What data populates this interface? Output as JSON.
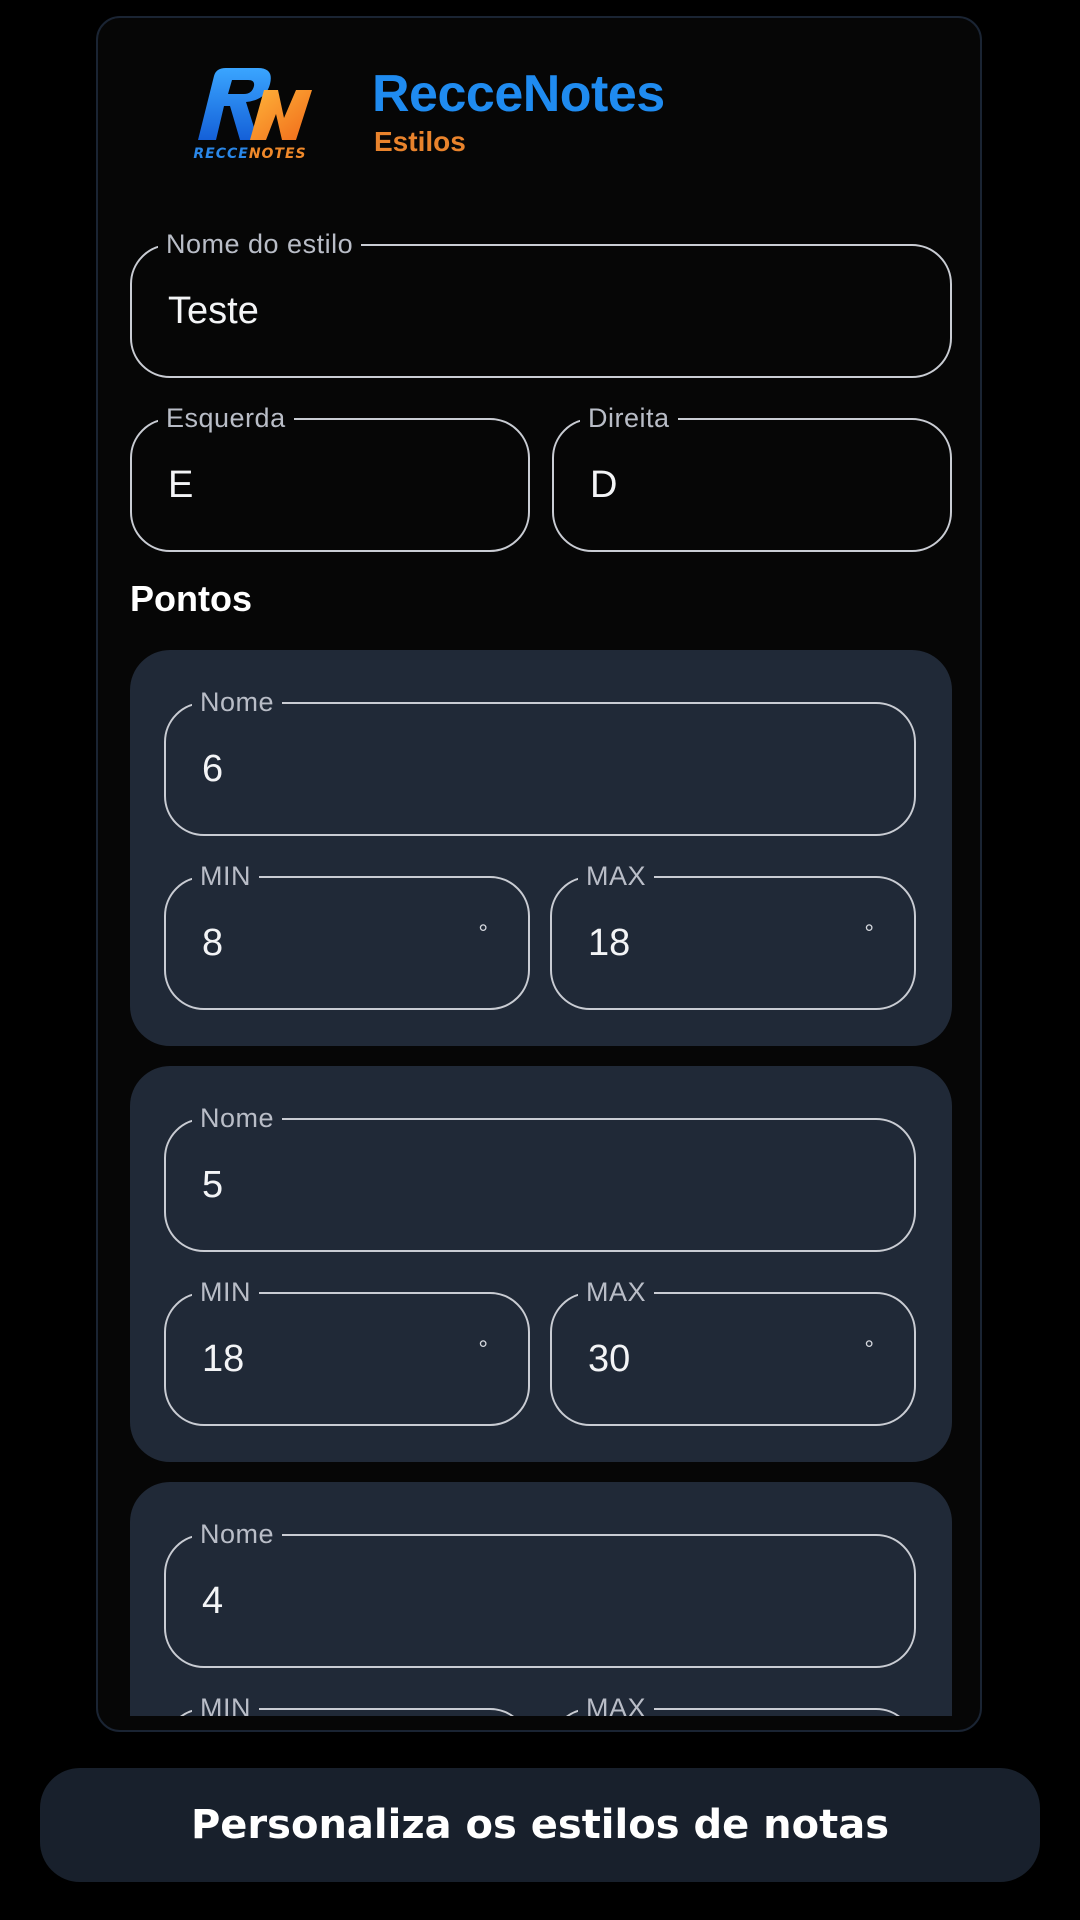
{
  "header": {
    "title": "RecceNotes",
    "subtitle": "Estilos",
    "logo_word_part1": "RECCE",
    "logo_word_part2": "NOTES"
  },
  "form": {
    "style_name": {
      "label": "Nome do estilo",
      "value": "Teste"
    },
    "left": {
      "label": "Esquerda",
      "value": "E"
    },
    "right": {
      "label": "Direita",
      "value": "D"
    }
  },
  "section": {
    "points_title": "Pontos"
  },
  "points": [
    {
      "name_label": "Nome",
      "name": "6",
      "min_label": "MIN",
      "min": "8",
      "max_label": "MAX",
      "max": "18",
      "unit": "°"
    },
    {
      "name_label": "Nome",
      "name": "5",
      "min_label": "MIN",
      "min": "18",
      "max_label": "MAX",
      "max": "30",
      "unit": "°"
    },
    {
      "name_label": "Nome",
      "name": "4",
      "min_label": "MIN",
      "min": "",
      "max_label": "MAX",
      "max": "",
      "unit": "°"
    }
  ],
  "footer": {
    "caption": "Personaliza os estilos de notas"
  },
  "colors": {
    "accent_blue": "#1f8bf0",
    "accent_orange": "#e9832c",
    "card_bg": "#202937",
    "page_bg": "#000000"
  }
}
